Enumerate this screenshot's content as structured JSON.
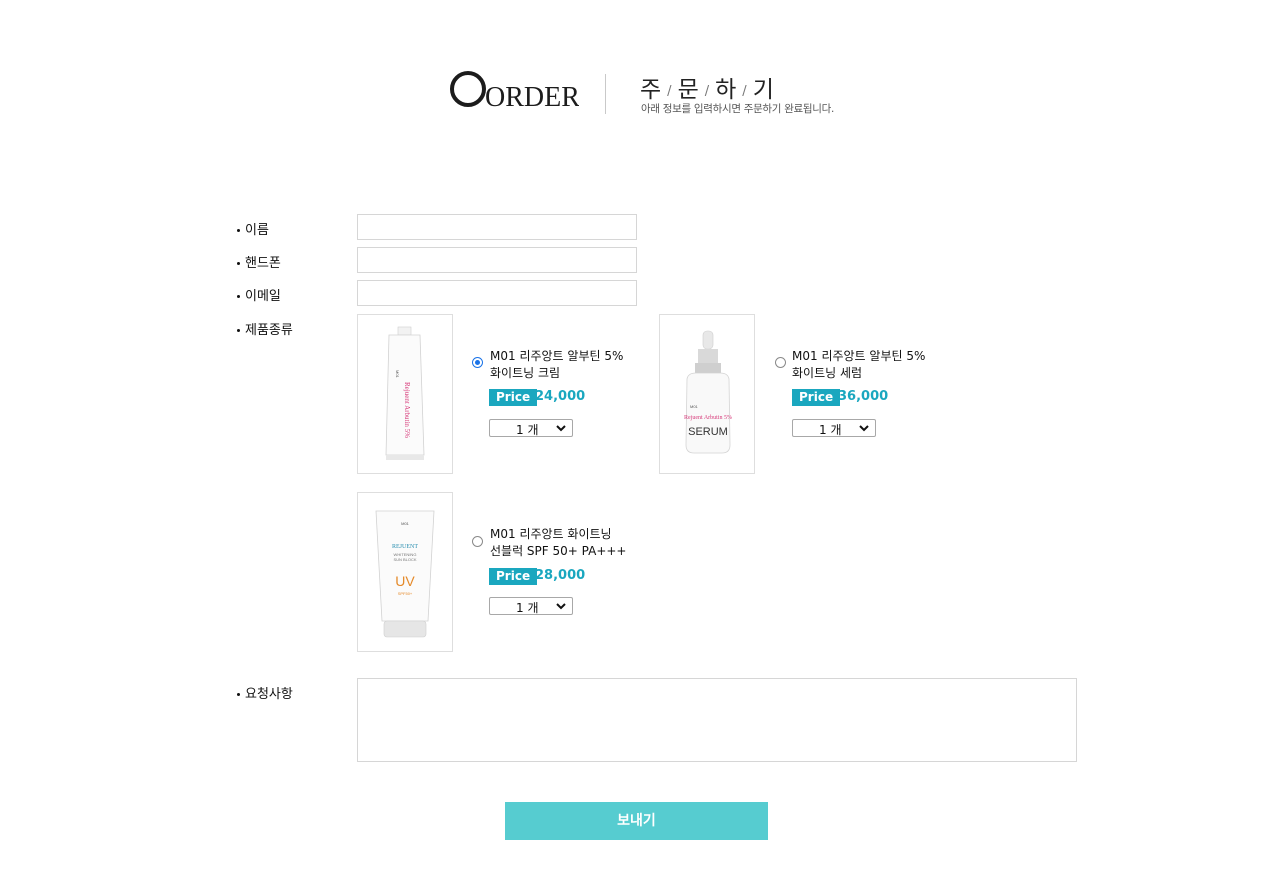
{
  "header": {
    "logo_text": "ORDER",
    "title_chars": [
      "주",
      "문",
      "하",
      "기"
    ],
    "subtitle": "아래 정보를 입력하시면 주문하기 완료됩니다."
  },
  "form": {
    "name_label": "이름",
    "phone_label": "핸드폰",
    "email_label": "이메일",
    "product_label": "제품종류",
    "request_label": "요청사항"
  },
  "products": [
    {
      "name_line1": "M01 리주앙트 알부틴 5%",
      "name_line2": "화이트닝 크림",
      "price_tag": "Price",
      "price": "24,000",
      "qty": "1 개",
      "selected": true,
      "image_icon": "cream-tube-icon",
      "image_text": "Rejuent Arbutin 5%"
    },
    {
      "name_line1": "M01 리주앙트 알부틴 5%",
      "name_line2": "화이트닝 세럼",
      "price_tag": "Price",
      "price": "36,000",
      "qty": "1 개",
      "selected": false,
      "image_icon": "serum-bottle-icon",
      "image_text": "SERUM"
    },
    {
      "name_line1": "M01 리주앙트 화이트닝",
      "name_line2": "선블럭 SPF 50+ PA+++",
      "price_tag": "Price",
      "price": "28,000",
      "qty": "1 개",
      "selected": false,
      "image_icon": "sunblock-tube-icon",
      "image_text": "UV"
    }
  ],
  "submit_label": "보내기",
  "colors": {
    "accent": "#1aa7bf",
    "button": "#56ccd0",
    "radio_selected": "#1a73e8"
  }
}
